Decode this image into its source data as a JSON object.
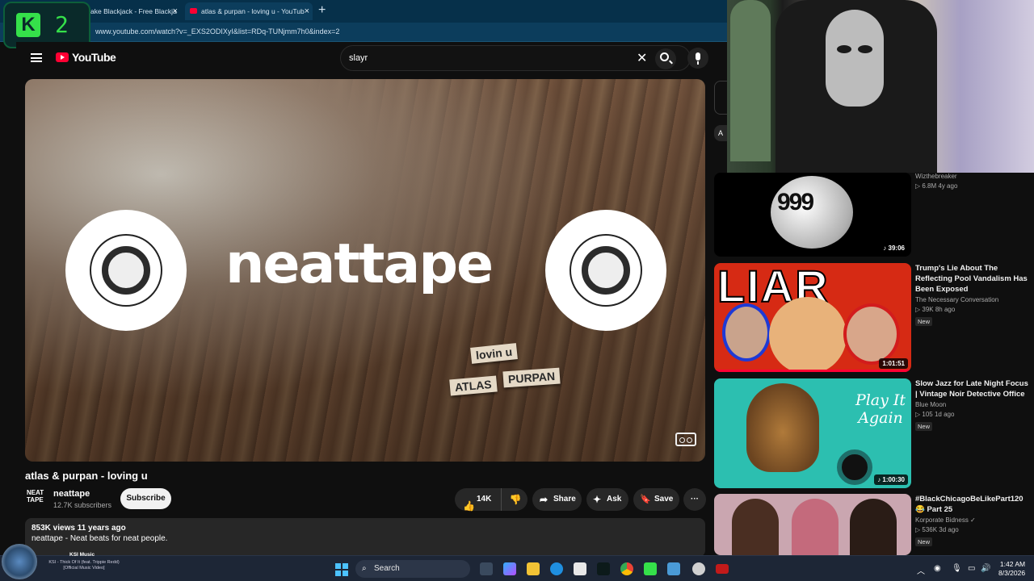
{
  "browser": {
    "tabs": [
      {
        "label": "ake Blackjack - Free Blackja"
      },
      {
        "label": "atlas & purpan - loving u - YouTub"
      }
    ],
    "new_tab": "+",
    "url": "www.youtube.com/watch?v=_EXS2ODIXyI&list=RDq-TUNjmm7h0&index=2",
    "overlay_logo": {
      "letter": "K",
      "number": "2",
      "accent": "#35e04a"
    }
  },
  "youtube": {
    "logo_text": "YouTube",
    "search_value": "slayr"
  },
  "player": {
    "brand_text": "neattape",
    "tiles": [
      "lovin u",
      "ATLAS",
      "PURPAN"
    ]
  },
  "video": {
    "title": "atlas & purpan - loving u",
    "channel": {
      "avatar_text": "NEAT TAPE",
      "name": "neattape",
      "subscribers": "12.7K subscribers"
    },
    "subscribe_label": "Subscribe",
    "likes": "14K",
    "share_label": "Share",
    "ask_label": "Ask",
    "save_label": "Save",
    "more_label": "···",
    "description": {
      "meta": "853K views  11 years ago",
      "text": "neattape - Neat beats for neat people."
    }
  },
  "sidebar": {
    "cut_chip": "A",
    "recommendations": [
      {
        "thumb_text": "999",
        "duration": "39:06",
        "title": "",
        "channel": "Wizthebreaker",
        "stats": "▷ 6.8M  4y ago",
        "badge": ""
      },
      {
        "thumb_text": "LIAR",
        "duration": "1:01:51",
        "title": "Trump's Lie About The Reflecting Pool Vandalism Has Been Exposed",
        "channel": "The Necessary Conversation",
        "stats": "▷ 39K  8h ago",
        "badge": "New"
      },
      {
        "thumb_text": "Play It Again",
        "duration": "1:00:30",
        "title": "Slow Jazz for Late Night Focus | Vintage Noir Detective Office",
        "channel": "Blue Moon",
        "stats": "▷ 105  1d ago",
        "badge": "New"
      },
      {
        "thumb_text": "",
        "duration": "",
        "title": "#BlackChicagoBeLikePart120😂 Part 25",
        "channel": "Korporate Bidness ✓",
        "stats": "▷ 536K  3d ago",
        "badge": "New"
      }
    ]
  },
  "taskbar": {
    "now_playing": {
      "title": "KSI Music",
      "subtitle": "KSI - Thick Of It (feat. Trippie Redd) [Official Music Video]"
    },
    "search_label": "Search",
    "time": "1:42 AM",
    "date": "8/3/2026"
  }
}
